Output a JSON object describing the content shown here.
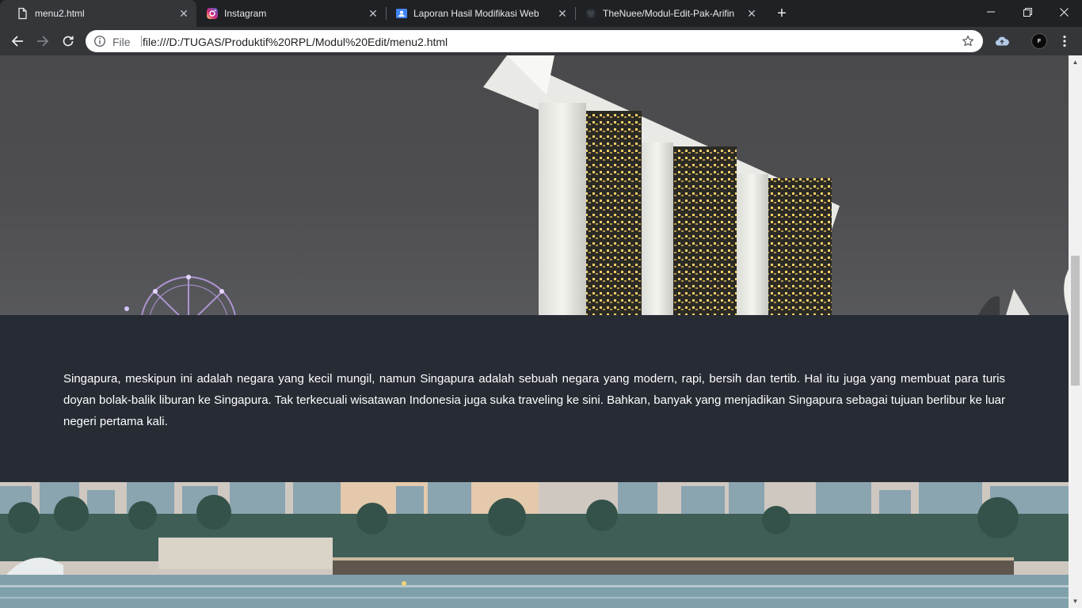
{
  "browser": {
    "tabs": [
      {
        "title": "menu2.html",
        "icon": "document-icon",
        "active": true
      },
      {
        "title": "Instagram",
        "icon": "instagram-icon",
        "active": false
      },
      {
        "title": "Laporan Hasil Modifikasi Web",
        "icon": "google-slides-icon",
        "active": false
      },
      {
        "title": "TheNuee/Modul-Edit-Pak-Arifin",
        "icon": "github-icon",
        "active": false
      }
    ],
    "new_tab_symbol": "+",
    "close_symbol": "✕",
    "scheme_label": "File",
    "url": "file:///D:/TUGAS/Produktif%20RPL/Modul%20Edit/menu2.html",
    "profile_initial": "F"
  },
  "page": {
    "paragraph": "Singapura, meskipun ini adalah negara yang kecil mungil, namun Singapura adalah sebuah negara yang modern, rapi, bersih dan tertib. Hal itu juga yang membuat para turis doyan bolak-balik liburan ke Singapura. Tak terkecuali wisatawan Indonesia juga suka traveling ke sini. Bahkan, banyak yang menjadikan Singapura sebagai tujuan berlibur ke luar negeri pertama kali.",
    "band_color": "#272b34"
  },
  "colors": {
    "tabstrip": "#202124",
    "toolbar": "#35363a"
  }
}
